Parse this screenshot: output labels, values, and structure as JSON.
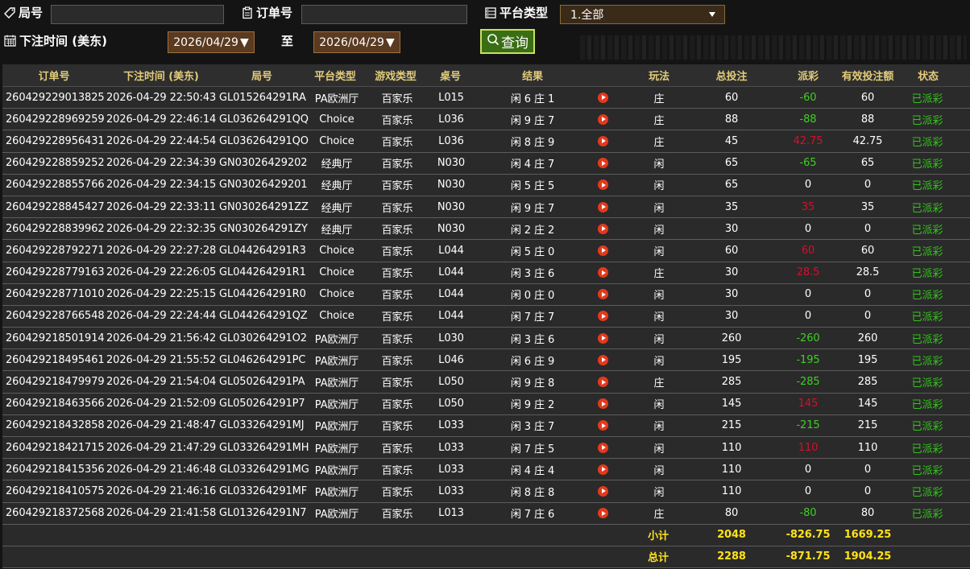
{
  "filters": {
    "game_no_label": "局号",
    "order_no_label": "订单号",
    "platform_label": "平台类型",
    "platform_value": "1.全部",
    "bet_time_label": "下注时间 (美东)",
    "date_from": "2026/04/29",
    "to_label": "至",
    "date_to": "2026/04/29",
    "search_label": "查询"
  },
  "table": {
    "headers": [
      "订单号",
      "下注时间 (美东)",
      "局号",
      "平台类型",
      "游戏类型",
      "桌号",
      "结果",
      "玩法",
      "总投注",
      "派彩",
      "有效投注额",
      "状态"
    ],
    "rows": [
      {
        "order": "260429229013825",
        "time": "2026-04-29 22:50:43",
        "game": "GL015264291RA",
        "platform": "PA欧洲厅",
        "type": "百家乐",
        "table": "L015",
        "result": "闲 6 庄 1",
        "play": "庄",
        "bet": "60",
        "payout": "-60",
        "payout_color": "green",
        "valid": "60",
        "status": "已派彩"
      },
      {
        "order": "260429228969259",
        "time": "2026-04-29 22:46:14",
        "game": "GL036264291QQ",
        "platform": "Choice",
        "type": "百家乐",
        "table": "L036",
        "result": "闲 9 庄 7",
        "play": "庄",
        "bet": "88",
        "payout": "-88",
        "payout_color": "green",
        "valid": "88",
        "status": "已派彩"
      },
      {
        "order": "260429228956431",
        "time": "2026-04-29 22:44:54",
        "game": "GL036264291QO",
        "platform": "Choice",
        "type": "百家乐",
        "table": "L036",
        "result": "闲 8 庄 9",
        "play": "庄",
        "bet": "45",
        "payout": "42.75",
        "payout_color": "red",
        "valid": "42.75",
        "status": "已派彩"
      },
      {
        "order": "260429228859252",
        "time": "2026-04-29 22:34:39",
        "game": "GN03026429202",
        "platform": "经典厅",
        "type": "百家乐",
        "table": "N030",
        "result": "闲 4 庄 7",
        "play": "闲",
        "bet": "65",
        "payout": "-65",
        "payout_color": "green",
        "valid": "65",
        "status": "已派彩"
      },
      {
        "order": "260429228855766",
        "time": "2026-04-29 22:34:15",
        "game": "GN03026429201",
        "platform": "经典厅",
        "type": "百家乐",
        "table": "N030",
        "result": "闲 5 庄 5",
        "play": "闲",
        "bet": "65",
        "payout": "0",
        "payout_color": "white",
        "valid": "0",
        "status": "已派彩"
      },
      {
        "order": "260429228845427",
        "time": "2026-04-29 22:33:11",
        "game": "GN030264291ZZ",
        "platform": "经典厅",
        "type": "百家乐",
        "table": "N030",
        "result": "闲 9 庄 7",
        "play": "闲",
        "bet": "35",
        "payout": "35",
        "payout_color": "red",
        "valid": "35",
        "status": "已派彩"
      },
      {
        "order": "260429228839962",
        "time": "2026-04-29 22:32:35",
        "game": "GN030264291ZY",
        "platform": "经典厅",
        "type": "百家乐",
        "table": "N030",
        "result": "闲 2 庄 2",
        "play": "闲",
        "bet": "30",
        "payout": "0",
        "payout_color": "white",
        "valid": "0",
        "status": "已派彩"
      },
      {
        "order": "260429228792271",
        "time": "2026-04-29 22:27:28",
        "game": "GL044264291R3",
        "platform": "Choice",
        "type": "百家乐",
        "table": "L044",
        "result": "闲 5 庄 0",
        "play": "闲",
        "bet": "60",
        "payout": "60",
        "payout_color": "red",
        "valid": "60",
        "status": "已派彩"
      },
      {
        "order": "260429228779163",
        "time": "2026-04-29 22:26:05",
        "game": "GL044264291R1",
        "platform": "Choice",
        "type": "百家乐",
        "table": "L044",
        "result": "闲 3 庄 6",
        "play": "庄",
        "bet": "30",
        "payout": "28.5",
        "payout_color": "red",
        "valid": "28.5",
        "status": "已派彩"
      },
      {
        "order": "260429228771010",
        "time": "2026-04-29 22:25:15",
        "game": "GL044264291R0",
        "platform": "Choice",
        "type": "百家乐",
        "table": "L044",
        "result": "闲 0 庄 0",
        "play": "闲",
        "bet": "30",
        "payout": "0",
        "payout_color": "white",
        "valid": "0",
        "status": "已派彩"
      },
      {
        "order": "260429228766548",
        "time": "2026-04-29 22:24:44",
        "game": "GL044264291QZ",
        "platform": "Choice",
        "type": "百家乐",
        "table": "L044",
        "result": "闲 7 庄 7",
        "play": "闲",
        "bet": "30",
        "payout": "0",
        "payout_color": "white",
        "valid": "0",
        "status": "已派彩"
      },
      {
        "order": "260429218501914",
        "time": "2026-04-29 21:56:42",
        "game": "GL030264291O2",
        "platform": "PA欧洲厅",
        "type": "百家乐",
        "table": "L030",
        "result": "闲 3 庄 6",
        "play": "闲",
        "bet": "260",
        "payout": "-260",
        "payout_color": "green",
        "valid": "260",
        "status": "已派彩"
      },
      {
        "order": "260429218495461",
        "time": "2026-04-29 21:55:52",
        "game": "GL046264291PC",
        "platform": "PA欧洲厅",
        "type": "百家乐",
        "table": "L046",
        "result": "闲 6 庄 9",
        "play": "闲",
        "bet": "195",
        "payout": "-195",
        "payout_color": "green",
        "valid": "195",
        "status": "已派彩"
      },
      {
        "order": "260429218479979",
        "time": "2026-04-29 21:54:04",
        "game": "GL050264291PA",
        "platform": "PA欧洲厅",
        "type": "百家乐",
        "table": "L050",
        "result": "闲 9 庄 8",
        "play": "庄",
        "bet": "285",
        "payout": "-285",
        "payout_color": "green",
        "valid": "285",
        "status": "已派彩"
      },
      {
        "order": "260429218463566",
        "time": "2026-04-29 21:52:09",
        "game": "GL050264291P7",
        "platform": "PA欧洲厅",
        "type": "百家乐",
        "table": "L050",
        "result": "闲 9 庄 2",
        "play": "闲",
        "bet": "145",
        "payout": "145",
        "payout_color": "red",
        "valid": "145",
        "status": "已派彩"
      },
      {
        "order": "260429218432858",
        "time": "2026-04-29 21:48:47",
        "game": "GL033264291MJ",
        "platform": "PA欧洲厅",
        "type": "百家乐",
        "table": "L033",
        "result": "闲 3 庄 7",
        "play": "闲",
        "bet": "215",
        "payout": "-215",
        "payout_color": "green",
        "valid": "215",
        "status": "已派彩"
      },
      {
        "order": "260429218421715",
        "time": "2026-04-29 21:47:29",
        "game": "GL033264291MH",
        "platform": "PA欧洲厅",
        "type": "百家乐",
        "table": "L033",
        "result": "闲 7 庄 5",
        "play": "闲",
        "bet": "110",
        "payout": "110",
        "payout_color": "red",
        "valid": "110",
        "status": "已派彩"
      },
      {
        "order": "260429218415356",
        "time": "2026-04-29 21:46:48",
        "game": "GL033264291MG",
        "platform": "PA欧洲厅",
        "type": "百家乐",
        "table": "L033",
        "result": "闲 4 庄 4",
        "play": "闲",
        "bet": "110",
        "payout": "0",
        "payout_color": "white",
        "valid": "0",
        "status": "已派彩"
      },
      {
        "order": "260429218410575",
        "time": "2026-04-29 21:46:16",
        "game": "GL033264291MF",
        "platform": "PA欧洲厅",
        "type": "百家乐",
        "table": "L033",
        "result": "闲 8 庄 8",
        "play": "闲",
        "bet": "110",
        "payout": "0",
        "payout_color": "white",
        "valid": "0",
        "status": "已派彩"
      },
      {
        "order": "260429218372568",
        "time": "2026-04-29 21:41:58",
        "game": "GL013264291N7",
        "platform": "PA欧洲厅",
        "type": "百家乐",
        "table": "L013",
        "result": "闲 7 庄 6",
        "play": "庄",
        "bet": "80",
        "payout": "-80",
        "payout_color": "green",
        "valid": "80",
        "status": "已派彩"
      }
    ],
    "subtotal": {
      "label": "小计",
      "bet": "2048",
      "payout": "-826.75",
      "valid": "1669.25"
    },
    "total": {
      "label": "总计",
      "bet": "2288",
      "payout": "-871.75",
      "valid": "1904.25"
    }
  },
  "colors": {
    "header_text": "#e2cc7a",
    "total_text": "#ffe21a",
    "status_text": "#32c41a",
    "loss_green": "#3fcf22",
    "win_red": "#d6102a"
  }
}
